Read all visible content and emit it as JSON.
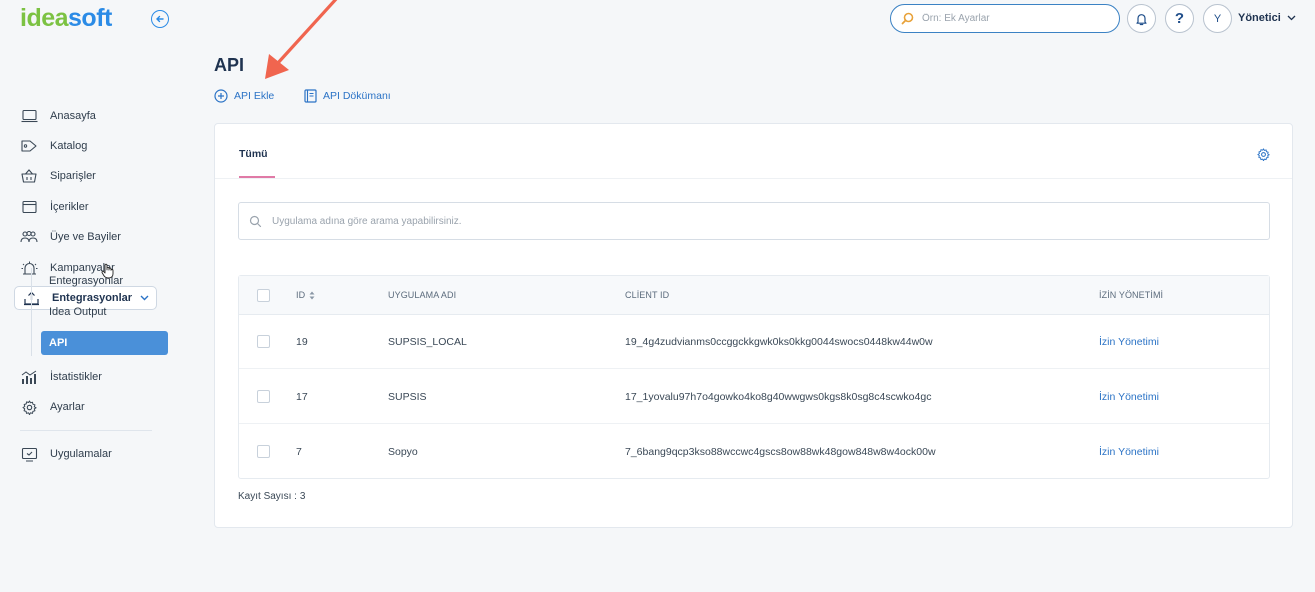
{
  "brand": {
    "logo_part1": "idea",
    "logo_part2": "soft",
    "green": "#7cc243",
    "blue": "#2b8be6"
  },
  "header": {
    "search_placeholder": "Örn: Ek Ayarlar",
    "help_label": "?",
    "avatar_initial": "Y",
    "user_name": "Yönetici",
    "icons": [
      "search-icon",
      "bell-icon",
      "help-icon",
      "chevron-down-icon"
    ]
  },
  "sidebar": {
    "items": [
      {
        "label": "Anasayfa",
        "icon": "laptop-icon"
      },
      {
        "label": "Katalog",
        "icon": "tag-icon"
      },
      {
        "label": "Siparişler",
        "icon": "basket-icon"
      },
      {
        "label": "İçerikler",
        "icon": "window-icon"
      },
      {
        "label": "Üye ve Bayiler",
        "icon": "users-icon"
      },
      {
        "label": "Kampanyalar",
        "icon": "campaign-icon"
      },
      {
        "label": "Entegrasyonlar",
        "icon": "integration-icon"
      }
    ],
    "subitems": [
      {
        "label": "Entegrasyonlar"
      },
      {
        "label": "Idea Output"
      },
      {
        "label": "API"
      }
    ],
    "items_after": [
      {
        "label": "İstatistikler",
        "icon": "stats-icon"
      },
      {
        "label": "Ayarlar",
        "icon": "gear-icon"
      }
    ],
    "apps": {
      "label": "Uygulamalar",
      "icon": "apps-icon"
    }
  },
  "main": {
    "title": "API",
    "actions": {
      "add": "API Ekle",
      "docs": "API Dökümanı"
    },
    "tabs": [
      {
        "label": "Tümü"
      }
    ],
    "search_placeholder": "Uygulama adına göre arama yapabilirsiniz.",
    "columns": {
      "id": "ID",
      "app_name": "UYGULAMA ADI",
      "client_id": "CLİENT ID",
      "permissions": "İZİN YÖNETİMİ"
    },
    "rows": [
      {
        "id": "19",
        "name": "SUPSIS_LOCAL",
        "client_id": "19_4g4zudvianms0ccggckkgwk0ks0kkg0044swocs0448kw44w0w",
        "permission": "İzin Yönetimi"
      },
      {
        "id": "17",
        "name": "SUPSIS",
        "client_id": "17_1yovalu97h7o4gowko4ko8g40wwgws0kgs8k0sg8c4scwko4gc",
        "permission": "İzin Yönetimi"
      },
      {
        "id": "7",
        "name": "Sopyo",
        "client_id": "7_6bang9qcp3kso88wccwc4gscs8ow88wk48gow848w8w4ock00w",
        "permission": "İzin Yönetimi"
      }
    ],
    "record_count_label": "Kayıt Sayısı :",
    "record_count": "3"
  },
  "colors": {
    "accent": "#2b73c6",
    "active_bg": "#4a90d9",
    "tab_underline": "#e07aa6",
    "annotation_arrow": "#f0654f"
  }
}
